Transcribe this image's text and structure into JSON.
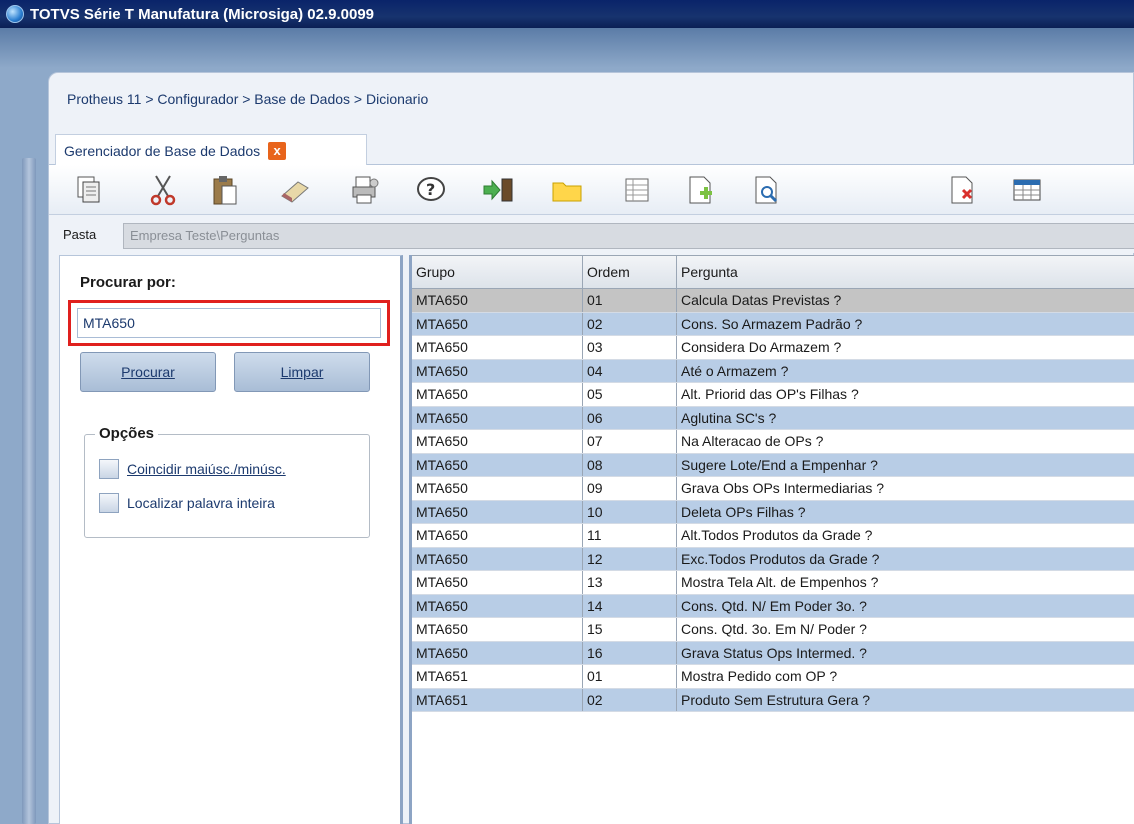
{
  "window": {
    "title": "TOTVS Série T Manufatura (Microsiga) 02.9.0099"
  },
  "breadcrumb": "Protheus 11 > Configurador > Base de Dados > Dicionario",
  "tab": {
    "label": "Gerenciador de Base de Dados",
    "close": "x"
  },
  "toolbar": {
    "icons": [
      "copy-icon",
      "cut-icon",
      "paste-icon",
      "eraser-icon",
      "print-icon",
      "help-icon",
      "exit-icon",
      "folder-icon",
      "grid-icon",
      "add-doc-icon",
      "preview-icon",
      "delete-doc-icon",
      "table-icon"
    ]
  },
  "pasta": {
    "label": "Pasta",
    "value": "Empresa Teste\\Perguntas"
  },
  "search": {
    "title": "Procurar por:",
    "value": "MTA650",
    "procurar_label": "Procurar",
    "limpar_label": "Limpar",
    "options_title": "Opções",
    "opt_case": "Coincidir maiúsc./minúsc.",
    "opt_whole": "Localizar palavra inteira"
  },
  "grid": {
    "headers": [
      "Grupo",
      "Ordem",
      "Pergunta"
    ],
    "rows": [
      [
        "MTA650",
        "01",
        "Calcula Datas Previstas ?"
      ],
      [
        "MTA650",
        "02",
        "Cons. So Armazem Padrão ?"
      ],
      [
        "MTA650",
        "03",
        "Considera Do Armazem ?"
      ],
      [
        "MTA650",
        "04",
        "Até o Armazem ?"
      ],
      [
        "MTA650",
        "05",
        "Alt. Priorid das OP's Filhas ?"
      ],
      [
        "MTA650",
        "06",
        "Aglutina SC's ?"
      ],
      [
        "MTA650",
        "07",
        "Na Alteracao de OPs ?"
      ],
      [
        "MTA650",
        "08",
        "Sugere Lote/End a Empenhar ?"
      ],
      [
        "MTA650",
        "09",
        "Grava Obs OPs Intermediarias ?"
      ],
      [
        "MTA650",
        "10",
        "Deleta OPs Filhas ?"
      ],
      [
        "MTA650",
        "11",
        "Alt.Todos Produtos da Grade ?"
      ],
      [
        "MTA650",
        "12",
        "Exc.Todos Produtos da Grade ?"
      ],
      [
        "MTA650",
        "13",
        "Mostra Tela Alt. de Empenhos ?"
      ],
      [
        "MTA650",
        "14",
        "Cons. Qtd. N/ Em Poder 3o. ?"
      ],
      [
        "MTA650",
        "15",
        "Cons. Qtd. 3o. Em N/ Poder ?"
      ],
      [
        "MTA650",
        "16",
        "Grava Status Ops Intermed. ?"
      ],
      [
        "MTA651",
        "01",
        "Mostra Pedido com OP ?"
      ],
      [
        "MTA651",
        "02",
        "Produto Sem Estrutura Gera ?"
      ]
    ]
  }
}
